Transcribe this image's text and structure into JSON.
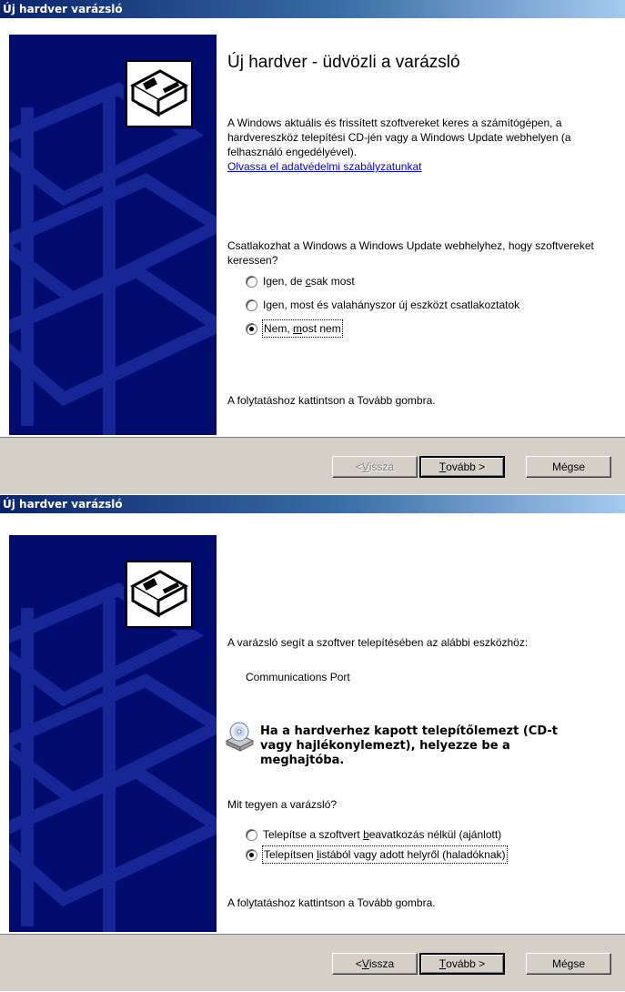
{
  "dialog1": {
    "title": "Új hardver varázsló",
    "heading": "Új hardver - üdvözli a varázsló",
    "intro": "A Windows aktuális és frissített szoftvereket keres a számítógépen, a hardvereszköz telepítési CD-jén vagy a Windows Update webhelyen (a felhasználó engedélyével).",
    "privacy_link": "Olvassa el adatvédelmi szabályzatunkat",
    "question": "Csatlakozhat a Windows a Windows Update webhelyhez, hogy szoftvereket keressen?",
    "options": [
      {
        "label": "Igen, de csak most",
        "checked": false
      },
      {
        "label": "Igen, most és valahányszor új eszközt csatlakoztatok",
        "checked": false
      },
      {
        "label": "Nem, most nem",
        "checked": true
      }
    ],
    "continue_text": "A folytatáshoz kattintson a Tovább gombra.",
    "buttons": {
      "back": "< Vissza",
      "next": "Tovább >",
      "cancel": "Mégse"
    },
    "back_enabled": false
  },
  "dialog2": {
    "title": "Új hardver varázsló",
    "helper_text": "A varázsló segít a szoftver telepítésében az alábbi eszközhöz:",
    "device_name": "Communications Port",
    "insert_message": "Ha a hardverhez kapott telepítőlemezt (CD-t vagy hajlékonylemezt), helyezze be a meghajtóba.",
    "question": "Mit tegyen a varázsló?",
    "options": [
      {
        "label": "Telepítse a szoftvert beavatkozás nélkül (ajánlott)",
        "checked": false
      },
      {
        "label": "Telepítsen listából vagy adott helyről (haladóknak)",
        "checked": true
      }
    ],
    "continue_text": "A folytatáshoz kattintson a Tovább gombra.",
    "buttons": {
      "back": "< Vissza",
      "next": "Tovább >",
      "cancel": "Mégse"
    },
    "back_enabled": true
  },
  "colors": {
    "title_start": "#0a246a",
    "title_end": "#a6caf0",
    "side_panel": "#000b6e",
    "link": "#0000cc",
    "button_face": "#d4d0c8"
  },
  "icons": {
    "wizard": "hardware-card-icon",
    "disc": "cd-drive-icon"
  }
}
